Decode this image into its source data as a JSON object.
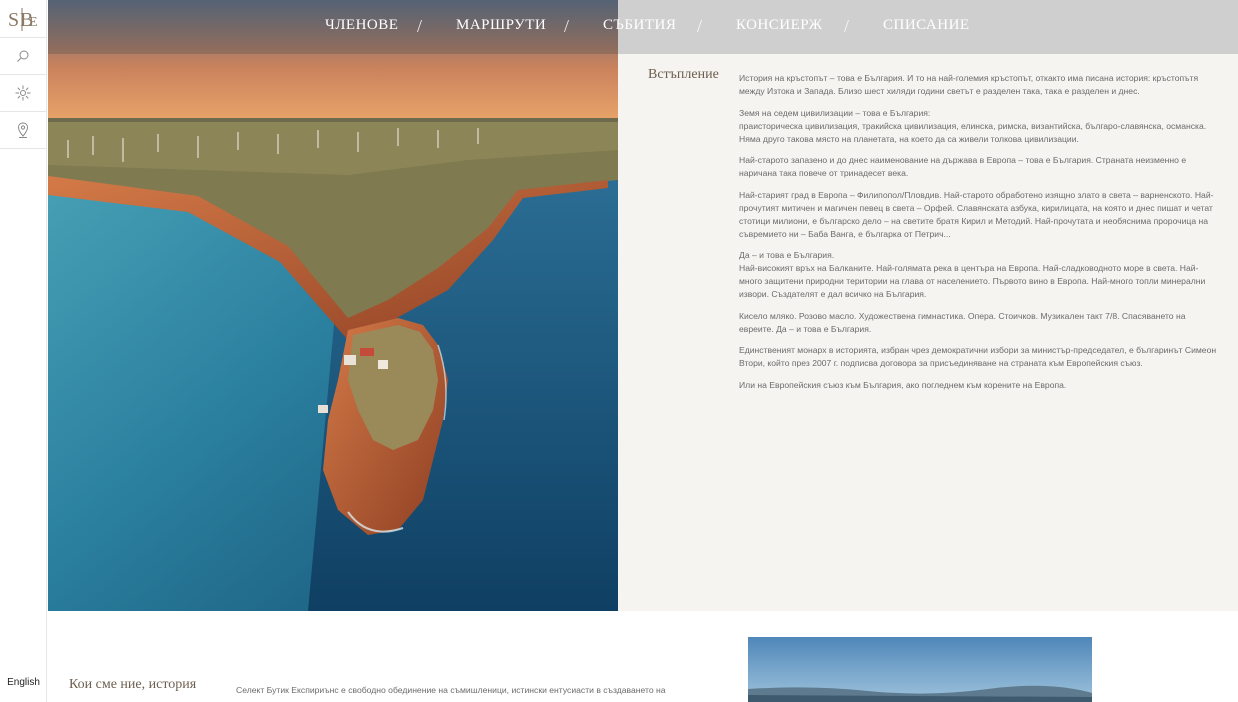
{
  "nav": {
    "items": [
      {
        "label": "ЧЛЕНОВЕ"
      },
      {
        "label": "МАРШРУТИ"
      },
      {
        "label": "СЪБИТИЯ"
      },
      {
        "label": "КОНСИЕРЖ"
      },
      {
        "label": "СПИСАНИЕ"
      }
    ],
    "separator": "/"
  },
  "sidebar": {
    "logo_text": "SBE",
    "icons": [
      "search-icon",
      "sun-icon",
      "location-pin-icon"
    ],
    "language_label": "English"
  },
  "intro": {
    "title": "Встъпление",
    "paragraphs": [
      "История на кръстопът – това е България. И то на най-големия кръстопът, откакто има писана история: кръстопътя между Изтока и Запада. Близо шест хиляди години светът е разделен така, така е разделен и днес.",
      "Земя на седем цивилизации – това е България:\nпраисторическа цивилизация, тракийска цивилизация, елинска, римска, византийска, българо-славянска, османска. Няма друго такова място на планетата, на което да са живели толкова цивилизации.",
      "Най-старото запазено и до днес наименование на държава в Европа – това е България. Страната неизменно е наричана така повече от тринадесет века.",
      "Най-старият град в Европа – Филипопол/Пловдив. Най-старото обработено изящно злато в света – варненското. Най-прочутият митичен и магичен певец в света – Орфей. Славянската азбука, кирилицата, на която и днес пишат и четат стотици милиони, е българско дело – на светите братя Кирил и Методий. Най-прочутата и необяснима пророчица на съвремието ни – Баба Ванга, е българка от Петрич...",
      "Да – и това е България.\nНай-високият връх на Балканите. Най-голямата река в центъра на Европа. Най-сладководното море в света. Най-много защитени природни територии на глава от населението. Първото вино в Европа. Най-много топли минерални извори. Създателят е дал всичко на България.",
      "Кисело мляко. Розово масло. Художествена гимнастика. Опера. Стоичков. Музикален такт 7/8. Спасяването на евреите. Да – и това е България.",
      "Единственият монарх в историята, избран чрез демократични избори за министър-председател, е българинът Симеон Втори, който през 2007 г. подписва договора за присъединяване на страната към Европейския съюз.",
      "Или на Европейския съюз към България, ако погледнем към корените на Европа."
    ]
  },
  "about": {
    "title": "Кои сме ние, история",
    "body": "Селект Бутик Експириънс е свободно обединение на съмишленици, истински ентусиасти в създаването на"
  },
  "colors": {
    "panel_bg": "#f5f4f1",
    "heading_brown": "#6d5f4f",
    "body_text": "#6b6b6b",
    "sea": "#1f6f93",
    "cliff": "#b8613a"
  }
}
